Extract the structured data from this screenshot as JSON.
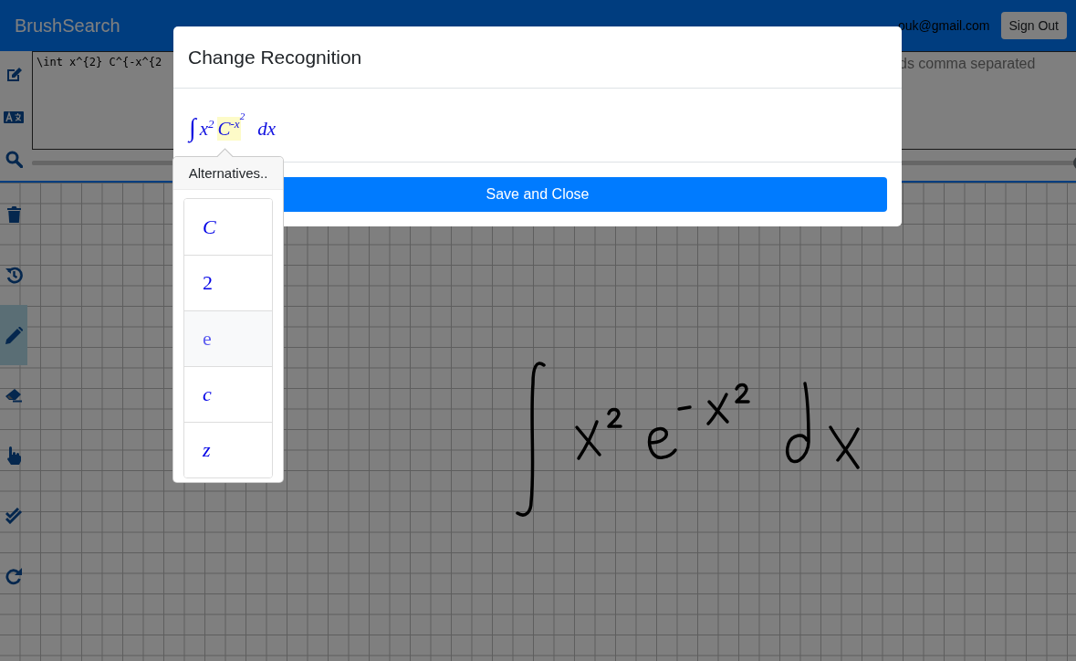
{
  "navbar": {
    "brand": "BrushSearch",
    "user_email": "ouk@gmail.com",
    "sign_out": "Sign Out"
  },
  "editor_tools": [
    {
      "kind": "edit",
      "selected": false
    },
    {
      "kind": "translate",
      "selected": false
    },
    {
      "kind": "search",
      "selected": false
    }
  ],
  "latex_input": {
    "value": "\\int x^{2} C^{-x^{2"
  },
  "keywords_input": {
    "placeholder": "ds comma separated"
  },
  "stroke_slider": {
    "level": 1
  },
  "canvas_tools": [
    {
      "kind": "trash",
      "selected": false
    },
    {
      "kind": "history",
      "selected": false
    },
    {
      "kind": "pencil",
      "selected": true
    },
    {
      "kind": "eraser",
      "selected": false
    },
    {
      "kind": "hand",
      "selected": false
    },
    {
      "kind": "check",
      "selected": false
    },
    {
      "kind": "redo",
      "selected": false
    }
  ],
  "dialog": {
    "title": "Change Recognition",
    "formula": [
      {
        "kind": "integral",
        "text": "∫",
        "highlighted": false
      },
      {
        "kind": "symbol",
        "text": "x$^{2}$",
        "highlighted": false
      },
      {
        "kind": "symbol",
        "text": "C$^{-x}$",
        "highlighted": true
      },
      {
        "kind": "high",
        "text": "$^{2}$",
        "highlighted": false
      },
      {
        "kind": "symbol",
        "text": "dx",
        "highlighted": false
      }
    ],
    "save_button": "Save and Close",
    "alternatives": {
      "title": "Alternatives..",
      "items": [
        {
          "text": "C",
          "italic": true,
          "highlighted": false
        },
        {
          "text": "2",
          "italic": false,
          "highlighted": false
        },
        {
          "text": "e",
          "italic": false,
          "highlighted": true
        },
        {
          "text": "c",
          "italic": true,
          "highlighted": false
        },
        {
          "text": "z",
          "italic": true,
          "highlighted": false
        }
      ]
    }
  }
}
